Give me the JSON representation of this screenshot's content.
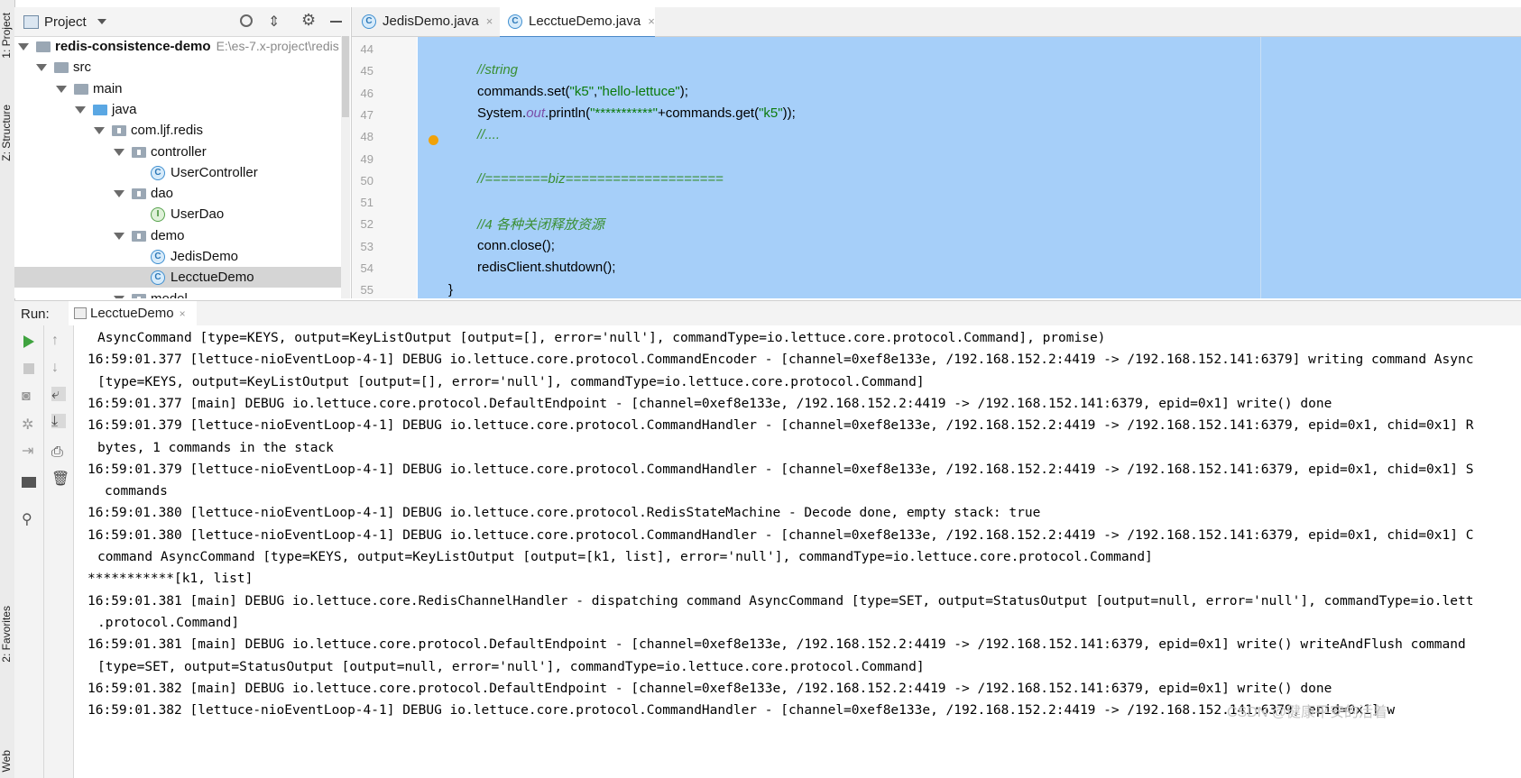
{
  "left_stripe": {
    "project_tab": "1: Project",
    "structure_tab": "Z: Structure",
    "favorites_tab": "2: Favorites",
    "web_tab": "Web"
  },
  "project": {
    "title": "Project",
    "tree": [
      {
        "label": "redis-consistence-demo",
        "hint": "E:\\es-7.x-project\\redis",
        "depth": 0,
        "kind": "module"
      },
      {
        "label": "src",
        "depth": 1,
        "kind": "folder"
      },
      {
        "label": "main",
        "depth": 2,
        "kind": "folder"
      },
      {
        "label": "java",
        "depth": 3,
        "kind": "src-folder"
      },
      {
        "label": "com.ljf.redis",
        "depth": 4,
        "kind": "package"
      },
      {
        "label": "controller",
        "depth": 5,
        "kind": "package"
      },
      {
        "label": "UserController",
        "depth": 6,
        "kind": "class"
      },
      {
        "label": "dao",
        "depth": 5,
        "kind": "package"
      },
      {
        "label": "UserDao",
        "depth": 6,
        "kind": "interface"
      },
      {
        "label": "demo",
        "depth": 5,
        "kind": "package"
      },
      {
        "label": "JedisDemo",
        "depth": 6,
        "kind": "class"
      },
      {
        "label": "LecctueDemo",
        "depth": 6,
        "kind": "class",
        "selected": true
      },
      {
        "label": "model",
        "depth": 5,
        "kind": "package"
      }
    ]
  },
  "editor": {
    "tabs": [
      {
        "label": "JedisDemo.java",
        "active": false
      },
      {
        "label": "LecctueDemo.java",
        "active": true
      }
    ],
    "close_glyph": "×",
    "line_numbers": [
      "44",
      "45",
      "46",
      "47",
      "48",
      "49",
      "50",
      "51",
      "52",
      "53",
      "54",
      "55"
    ],
    "code_lines": {
      "l45": "//string",
      "l46_a": "commands.set(",
      "l46_s1": "\"k5\"",
      "l46_b": ",",
      "l46_s2": "\"hello-lettuce\"",
      "l46_c": ");",
      "l47_a": "System.",
      "l47_f": "out",
      "l47_b": ".println(",
      "l47_s1": "\"***********\"",
      "l47_c": "+commands.get(",
      "l47_s2": "\"k5\"",
      "l47_d": "));",
      "l48": "//....",
      "l50": "//========biz====================",
      "l52": "//4 各种关闭释放资源",
      "l53": "conn.close();",
      "l54": "redisClient.shutdown();",
      "l55": "}"
    }
  },
  "run": {
    "label": "Run:",
    "tab": "LecctueDemo",
    "console_lines": [
      "AsyncCommand [type=KEYS, output=KeyListOutput [output=[], error='null'], commandType=io.lettuce.core.protocol.Command], promise)",
      "16:59:01.377 [lettuce-nioEventLoop-4-1] DEBUG io.lettuce.core.protocol.CommandEncoder - [channel=0xef8e133e, /192.168.152.2:4419 -> /192.168.152.141:6379] writing command Async",
      "[type=KEYS, output=KeyListOutput [output=[], error='null'], commandType=io.lettuce.core.protocol.Command]",
      "16:59:01.377 [main] DEBUG io.lettuce.core.protocol.DefaultEndpoint - [channel=0xef8e133e, /192.168.152.2:4419 -> /192.168.152.141:6379, epid=0x1] write() done",
      "16:59:01.379 [lettuce-nioEventLoop-4-1] DEBUG io.lettuce.core.protocol.CommandHandler - [channel=0xef8e133e, /192.168.152.2:4419 -> /192.168.152.141:6379, epid=0x1, chid=0x1] R",
      "bytes, 1 commands in the stack",
      "16:59:01.379 [lettuce-nioEventLoop-4-1] DEBUG io.lettuce.core.protocol.CommandHandler - [channel=0xef8e133e, /192.168.152.2:4419 -> /192.168.152.141:6379, epid=0x1, chid=0x1] S",
      "commands",
      "16:59:01.380 [lettuce-nioEventLoop-4-1] DEBUG io.lettuce.core.protocol.RedisStateMachine - Decode done, empty stack: true",
      "16:59:01.380 [lettuce-nioEventLoop-4-1] DEBUG io.lettuce.core.protocol.CommandHandler - [channel=0xef8e133e, /192.168.152.2:4419 -> /192.168.152.141:6379, epid=0x1, chid=0x1] C",
      "command AsyncCommand [type=KEYS, output=KeyListOutput [output=[k1, list], error='null'], commandType=io.lettuce.core.protocol.Command]",
      "***********[k1, list]",
      "16:59:01.381 [main] DEBUG io.lettuce.core.RedisChannelHandler - dispatching command AsyncCommand [type=SET, output=StatusOutput [output=null, error='null'], commandType=io.lett",
      ".protocol.Command]",
      "16:59:01.381 [main] DEBUG io.lettuce.core.protocol.DefaultEndpoint - [channel=0xef8e133e, /192.168.152.2:4419 -> /192.168.152.141:6379, epid=0x1] write() writeAndFlush command",
      "[type=SET, output=StatusOutput [output=null, error='null'], commandType=io.lettuce.core.protocol.Command]",
      "16:59:01.382 [main] DEBUG io.lettuce.core.protocol.DefaultEndpoint - [channel=0xef8e133e, /192.168.152.2:4419 -> /192.168.152.141:6379, epid=0x1] write() done",
      "16:59:01.382 [lettuce-nioEventLoop-4-1] DEBUG io.lettuce.core.protocol.CommandHandler - [channel=0xef8e133e, /192.168.152.2:4419 -> /192.168.152.141:6379, epid=0x1] w"
    ],
    "watermark": "CSDN @健康平安的活着"
  },
  "icons": [
    "project-icon",
    "dropdown-icon",
    "locate-icon",
    "collapse-icon",
    "gear-icon",
    "minimize-icon",
    "class-icon",
    "interface-icon",
    "folder-icon",
    "package-icon",
    "run-icon",
    "stop-icon",
    "up-icon",
    "down-icon",
    "camera-icon",
    "soft-wrap-icon",
    "scroll-end-icon",
    "print-icon",
    "trash-icon",
    "pin-icon",
    "bulb-icon"
  ],
  "colors": {
    "selection": "#a6cff9",
    "comment": "#3a8f33",
    "string": "#0b7a0b",
    "accent": "#4a88c7",
    "run": "#3fa33f"
  }
}
